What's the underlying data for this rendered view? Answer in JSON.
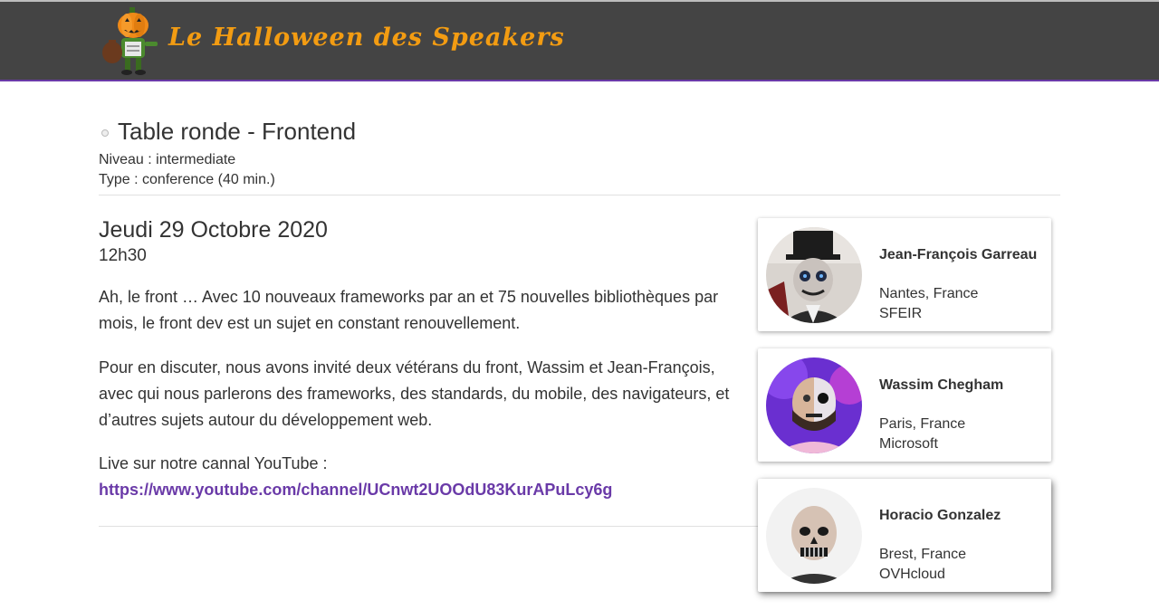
{
  "header": {
    "site_title": "Le Halloween des Speakers",
    "logo_icon": "pumpkin-mascot-logo"
  },
  "talk": {
    "title": "Table ronde - Frontend",
    "level_label": "Niveau :",
    "level_value": "intermediate",
    "type_label": "Type :",
    "type_value": "conference (40 min.)",
    "date": "Jeudi 29 Octobre 2020",
    "time": "12h30",
    "description": [
      "Ah, le front … Avec 10 nouveaux frameworks par an et 75 nouvelles bibliothèques par mois, le front dev est un sujet en constant renouvellement.",
      "Pour en discuter, nous avons invité deux vétérans du front, Wassim et Jean-François, avec qui nous parlerons des frameworks, des standards, du mobile, des navigateurs, et d’autres sujets autour du développement web."
    ],
    "live_label": "Live sur notre cannal YouTube :",
    "live_link": "https://www.youtube.com/channel/UCnwt2UOOdU83KurAPuLcy6g"
  },
  "speakers": [
    {
      "name": "Jean-François Garreau",
      "city": "Nantes, France",
      "company": "SFEIR"
    },
    {
      "name": "Wassim Chegham",
      "city": "Paris, France",
      "company": "Microsoft"
    },
    {
      "name": "Horacio Gonzalez",
      "city": "Brest, France",
      "company": "OVHcloud"
    }
  ],
  "colors": {
    "header_bg": "#444444",
    "logo_orange": "#f39c12",
    "link_purple": "#6a3aa8"
  }
}
